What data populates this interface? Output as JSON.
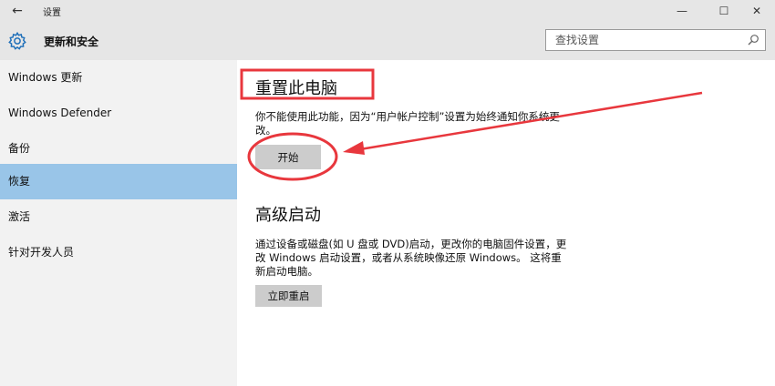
{
  "window": {
    "title": "设置",
    "back_icon": "←",
    "minimize_icon": "—",
    "maximize_icon": "☐",
    "close_icon": "✕"
  },
  "header": {
    "title": "更新和安全",
    "icon": "gear-icon",
    "search_placeholder": "查找设置",
    "accent_color": "#1e6fb9"
  },
  "sidebar": {
    "items": [
      {
        "label": "Windows 更新",
        "active": false
      },
      {
        "label": "Windows Defender",
        "active": false
      },
      {
        "label": "备份",
        "active": false
      },
      {
        "label": "恢复",
        "active": true
      },
      {
        "label": "激活",
        "active": false
      },
      {
        "label": "针对开发人员",
        "active": false
      }
    ],
    "active_color": "#99c5e8"
  },
  "reset": {
    "title": "重置此电脑",
    "line1": "你不能使用此功能，因为“用户帐户控制”设置为始终通知你系统更",
    "line2": "改。",
    "button": "开始"
  },
  "advanced": {
    "title": "高级启动",
    "line1": "通过设备或磁盘(如 U 盘或 DVD)启动，更改你的电脑固件设置，更",
    "line2": "改 Windows 启动设置，或者从系统映像还原 Windows。 这将重",
    "line3": "新启动电脑。",
    "button": "立即重启"
  },
  "annotation_color": "#e8373d"
}
